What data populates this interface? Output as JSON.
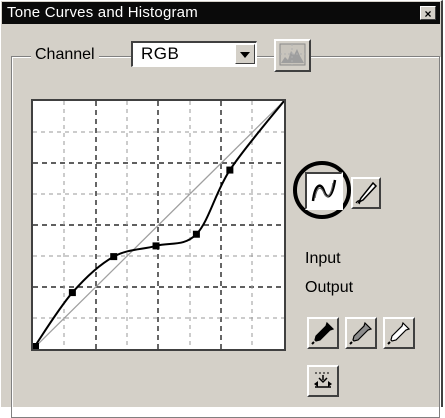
{
  "window": {
    "title": "Tone Curves and Histogram",
    "close_glyph": "×"
  },
  "channel": {
    "label": "Channel",
    "selected": "RGB"
  },
  "icons": {
    "close": "close-icon",
    "histogram": "histogram-icon",
    "curve_tool": "smooth-curve-icon",
    "pencil_tool": "pencil-icon",
    "black_point": "black-eyedropper-icon",
    "gray_point": "gray-eyedropper-icon",
    "white_point": "white-eyedropper-icon",
    "reset": "reset-curve-icon"
  },
  "readouts": {
    "input_label": "Input",
    "output_label": "Output"
  },
  "curve": {
    "range": [
      0,
      255
    ],
    "control_points": [
      {
        "input": 0,
        "output": 0
      },
      {
        "input": 40,
        "output": 58
      },
      {
        "input": 82,
        "output": 95
      },
      {
        "input": 125,
        "output": 106
      },
      {
        "input": 166,
        "output": 118
      },
      {
        "input": 200,
        "output": 184
      },
      {
        "input": 255,
        "output": 255
      }
    ]
  },
  "colors": {
    "dialog_bg": "#d4d0c8",
    "titlebar": "#0a0a0a",
    "curve": "#000000",
    "diagonal": "#a0a0a0"
  }
}
